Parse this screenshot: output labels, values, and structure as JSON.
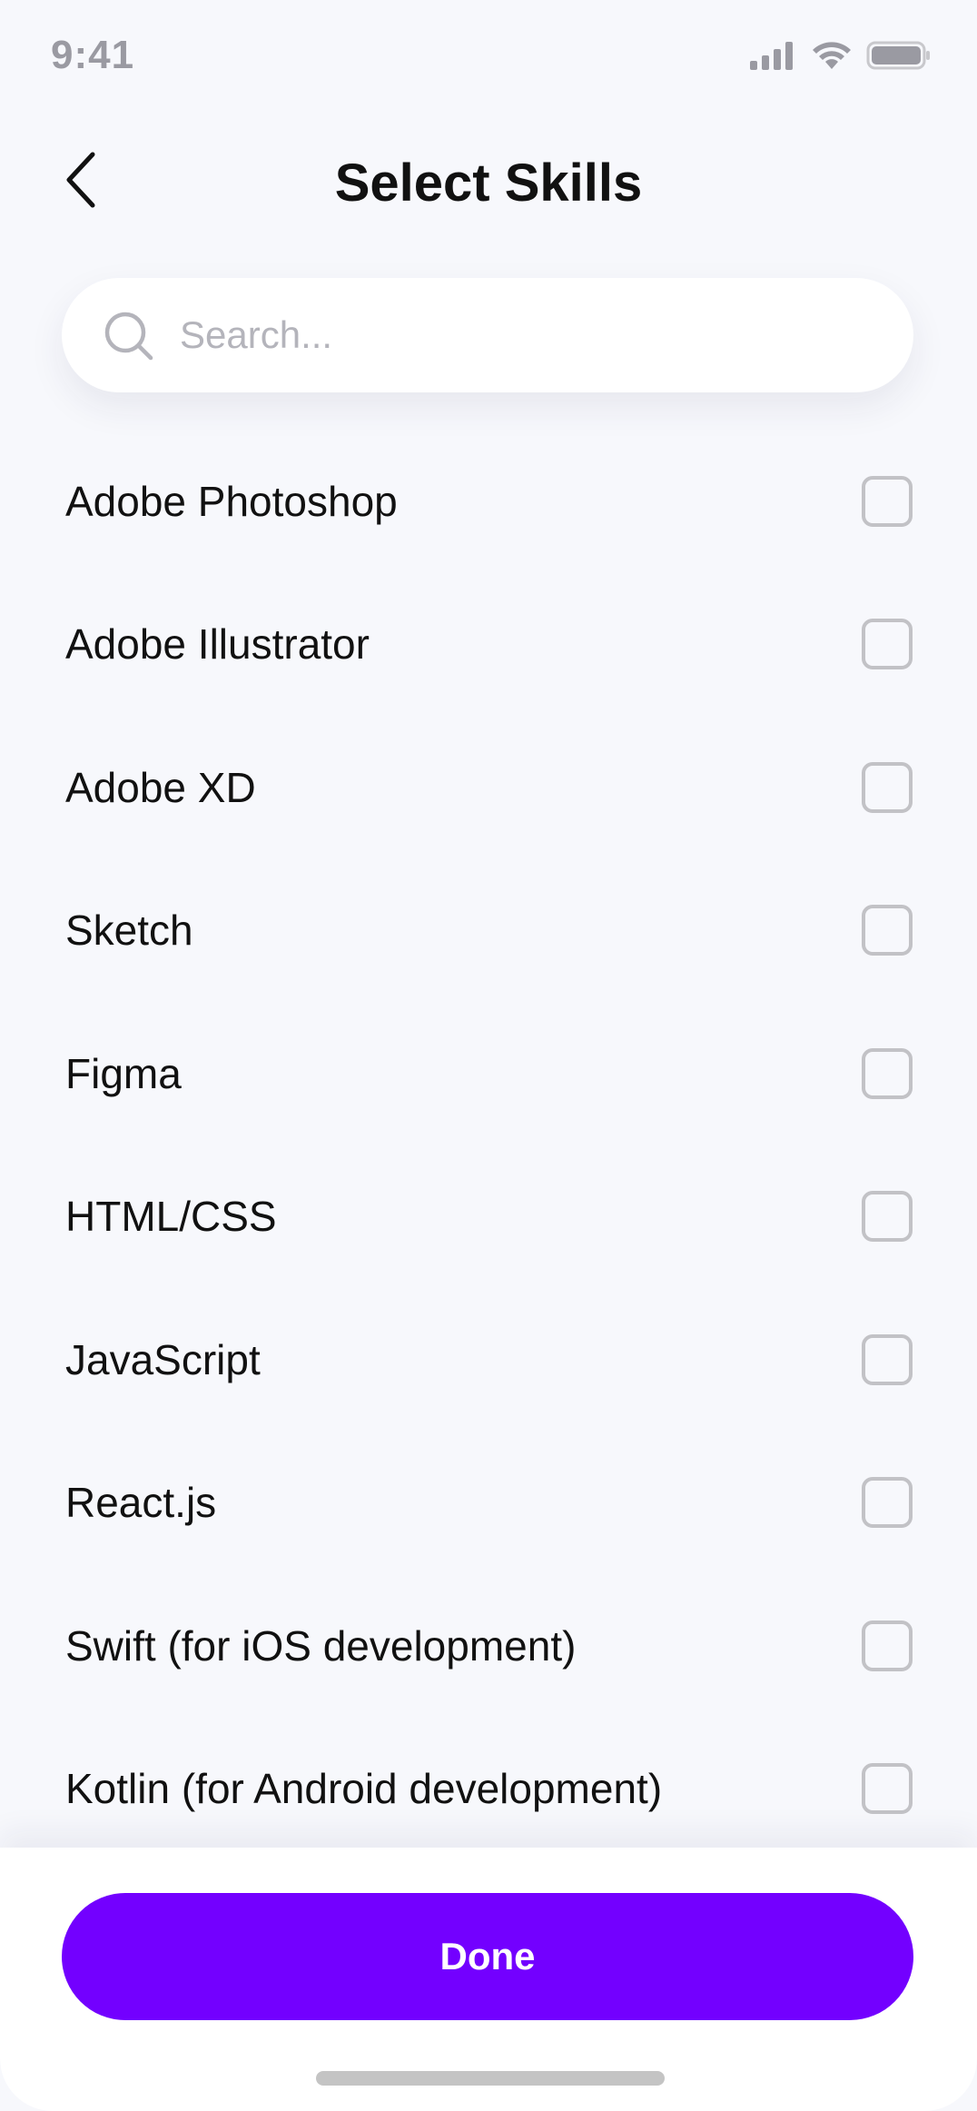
{
  "status_bar": {
    "time": "9:41",
    "icons": [
      "cellular-signal-icon",
      "wifi-icon",
      "battery-icon"
    ]
  },
  "header": {
    "title": "Select Skills",
    "back_icon": "chevron-left-icon"
  },
  "search": {
    "placeholder": "Search...",
    "value": "",
    "icon": "search-icon"
  },
  "skills": [
    {
      "label": "Adobe Photoshop",
      "checked": false
    },
    {
      "label": "Adobe Illustrator",
      "checked": false
    },
    {
      "label": "Adobe XD",
      "checked": false
    },
    {
      "label": "Sketch",
      "checked": false
    },
    {
      "label": "Figma",
      "checked": false
    },
    {
      "label": "HTML/CSS",
      "checked": false
    },
    {
      "label": "JavaScript",
      "checked": false
    },
    {
      "label": "React.js",
      "checked": false
    },
    {
      "label": "Swift (for iOS development)",
      "checked": false
    },
    {
      "label": "Kotlin (for Android development)",
      "checked": false
    }
  ],
  "footer": {
    "done_label": "Done"
  },
  "colors": {
    "accent": "#7300ff",
    "background": "#f7f8fc",
    "text": "#111111",
    "muted": "#9a9aa2",
    "checkbox_border": "#c2c2c6"
  }
}
